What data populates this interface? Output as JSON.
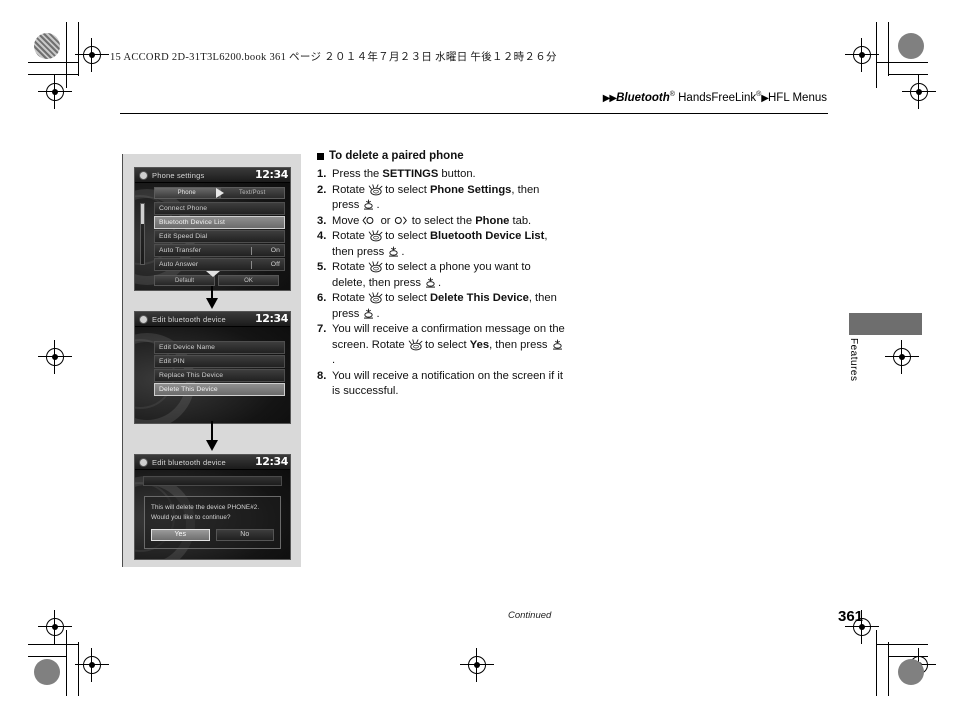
{
  "print_header": {
    "text": "15 ACCORD 2D-31T3L6200.book   361 ページ   ２０１４年７月２３日   水曜日   午後１２時２６分"
  },
  "breadcrumb": {
    "arrow1": "▶▶",
    "item1": "Bluetooth",
    "sup1": "®",
    "item2": "HandsFreeLink",
    "sup2": "®",
    "arrow2": "▶",
    "item3": "HFL Menus"
  },
  "side_tab": {
    "label": "Features"
  },
  "section": {
    "heading": "To delete a paired phone",
    "steps": [
      {
        "num": "1.",
        "parts": [
          {
            "t": "Press the ",
            "b": false
          },
          {
            "t": "SETTINGS",
            "b": true
          },
          {
            "t": " button.",
            "b": false
          }
        ]
      },
      {
        "num": "2.",
        "parts": [
          {
            "t": "Rotate ",
            "b": false
          },
          {
            "t": "[rotary-knob-icon]",
            "icon": "rotary"
          },
          {
            "t": " to select ",
            "b": false
          },
          {
            "t": "Phone Settings",
            "b": true
          },
          {
            "t": ", then press ",
            "b": false
          },
          {
            "t": "[press-knob-icon]",
            "icon": "press"
          },
          {
            "t": ".",
            "b": false
          }
        ]
      },
      {
        "num": "3.",
        "parts": [
          {
            "t": "Move ",
            "b": false
          },
          {
            "t": "[left-arrow-icon]",
            "icon": "left"
          },
          {
            "t": " or ",
            "b": false
          },
          {
            "t": "[right-arrow-icon]",
            "icon": "right"
          },
          {
            "t": " to select the ",
            "b": false
          },
          {
            "t": "Phone",
            "b": true
          },
          {
            "t": " tab.",
            "b": false
          }
        ]
      },
      {
        "num": "4.",
        "parts": [
          {
            "t": "Rotate ",
            "b": false
          },
          {
            "t": "[rotary-knob-icon]",
            "icon": "rotary"
          },
          {
            "t": " to select ",
            "b": false
          },
          {
            "t": "Bluetooth Device List",
            "b": true
          },
          {
            "t": ", then press ",
            "b": false
          },
          {
            "t": "[press-knob-icon]",
            "icon": "press"
          },
          {
            "t": ".",
            "b": false
          }
        ]
      },
      {
        "num": "5.",
        "parts": [
          {
            "t": "Rotate ",
            "b": false
          },
          {
            "t": "[rotary-knob-icon]",
            "icon": "rotary"
          },
          {
            "t": " to select a phone you want to delete, then press ",
            "b": false
          },
          {
            "t": "[press-knob-icon]",
            "icon": "press"
          },
          {
            "t": ".",
            "b": false
          }
        ]
      },
      {
        "num": "6.",
        "parts": [
          {
            "t": "Rotate ",
            "b": false
          },
          {
            "t": "[rotary-knob-icon]",
            "icon": "rotary"
          },
          {
            "t": " to select ",
            "b": false
          },
          {
            "t": "Delete This Device",
            "b": true
          },
          {
            "t": ", then press ",
            "b": false
          },
          {
            "t": "[press-knob-icon]",
            "icon": "press"
          },
          {
            "t": ".",
            "b": false
          }
        ]
      },
      {
        "num": "7.",
        "parts": [
          {
            "t": "You will receive a confirmation message on the screen. Rotate ",
            "b": false
          },
          {
            "t": "[rotary-knob-icon]",
            "icon": "rotary"
          },
          {
            "t": " to select ",
            "b": false
          },
          {
            "t": "Yes",
            "b": true
          },
          {
            "t": ", then press ",
            "b": false
          },
          {
            "t": "[press-knob-icon]",
            "icon": "press"
          },
          {
            "t": ".",
            "b": false
          }
        ]
      },
      {
        "num": "8.",
        "parts": [
          {
            "t": "You will receive a notification on the screen if it is successful.",
            "b": false
          }
        ]
      }
    ]
  },
  "illustrations": {
    "screen1": {
      "title": "Phone settings",
      "clock": "12:34",
      "tabs": [
        {
          "label": "Phone",
          "selected": true
        },
        {
          "label": "Text/Post",
          "selected": false
        }
      ],
      "rows": [
        {
          "label": "Connect Phone",
          "value": "",
          "selected": false
        },
        {
          "label": "Bluetooth Device List",
          "value": "",
          "selected": true
        },
        {
          "label": "Edit Speed Dial",
          "value": "",
          "selected": false
        },
        {
          "label": "Auto Transfer",
          "value": "On",
          "selected": false
        },
        {
          "label": "Auto Answer",
          "value": "Off",
          "selected": false
        }
      ],
      "buttons": [
        "Default",
        "OK"
      ]
    },
    "screen2": {
      "title": "Edit bluetooth device",
      "clock": "12:34",
      "rows": [
        {
          "label": "Edit Device Name",
          "selected": false
        },
        {
          "label": "Edit PIN",
          "selected": false
        },
        {
          "label": "Replace This Device",
          "selected": false
        },
        {
          "label": "Delete This Device",
          "selected": true
        }
      ]
    },
    "screen3": {
      "title": "Edit bluetooth device",
      "clock": "12:34",
      "message_line1": "This will delete the device PHONE#2.",
      "message_line2": "Would you like to continue?",
      "buttons": [
        {
          "label": "Yes",
          "selected": true
        },
        {
          "label": "No",
          "selected": false
        }
      ]
    }
  },
  "footer": {
    "continued": "Continued",
    "page_number": "361"
  }
}
